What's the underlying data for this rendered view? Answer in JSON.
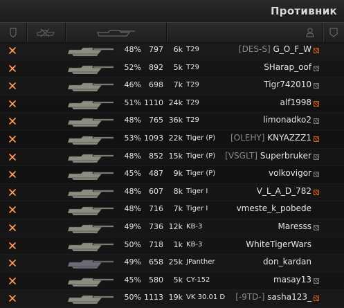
{
  "title": "Противник",
  "colors": {
    "dead_mark": "#c9561c",
    "tank_enemy": "#8c8c80",
    "tank_premium": "#6a6a78"
  },
  "rows": [
    {
      "pct": "48%",
      "battles": "797",
      "exp": "6k",
      "vehicle": "T29",
      "clan": "[DES-S]",
      "player": "G_O_F_W",
      "report": "orange"
    },
    {
      "pct": "52%",
      "battles": "892",
      "exp": "5k",
      "vehicle": "T29",
      "clan": "",
      "player": "SHarap_oof",
      "report": "grey"
    },
    {
      "pct": "46%",
      "battles": "698",
      "exp": "7k",
      "vehicle": "T29",
      "clan": "",
      "player": "Tigr742010",
      "report": "grey"
    },
    {
      "pct": "51%",
      "battles": "1110",
      "exp": "24k",
      "vehicle": "T29",
      "clan": "",
      "player": "alf1998",
      "report": "orange"
    },
    {
      "pct": "48%",
      "battles": "765",
      "exp": "36k",
      "vehicle": "T29",
      "clan": "",
      "player": "limonadko2",
      "report": "grey"
    },
    {
      "pct": "53%",
      "battles": "1093",
      "exp": "22k",
      "vehicle": "Tiger (P)",
      "clan": "[OLEHY]",
      "player": "KNYAZZZ1",
      "report": "orange"
    },
    {
      "pct": "48%",
      "battles": "852",
      "exp": "15k",
      "vehicle": "Tiger (P)",
      "clan": "[VSGLT]",
      "player": "Superbruker",
      "report": "grey"
    },
    {
      "pct": "45%",
      "battles": "487",
      "exp": "9k",
      "vehicle": "Tiger (P)",
      "clan": "",
      "player": "volkovigor",
      "report": "grey"
    },
    {
      "pct": "48%",
      "battles": "607",
      "exp": "8k",
      "vehicle": "Tiger I",
      "clan": "",
      "player": "V_L_A_D_782",
      "report": "orange"
    },
    {
      "pct": "48%",
      "battles": "716",
      "exp": "7k",
      "vehicle": "Tiger I",
      "clan": "",
      "player": "vmeste_k_pobede",
      "report": "none"
    },
    {
      "pct": "49%",
      "battles": "736",
      "exp": "12k",
      "vehicle": "KB-3",
      "clan": "",
      "player": "Maresss",
      "report": "grey"
    },
    {
      "pct": "50%",
      "battles": "718",
      "exp": "1k",
      "vehicle": "KB-3",
      "clan": "",
      "player": "WhiteTigerWars",
      "report": "none"
    },
    {
      "pct": "49%",
      "battles": "658",
      "exp": "25k",
      "vehicle": "JPanther",
      "clan": "",
      "player": "don_kardan",
      "report": "none"
    },
    {
      "pct": "45%",
      "battles": "580",
      "exp": "5k",
      "vehicle": "CY-152",
      "clan": "",
      "player": "masay13",
      "report": "grey"
    },
    {
      "pct": "50%",
      "battles": "1113",
      "exp": "19k",
      "vehicle": "VK 30.01 D",
      "clan": "[-9TD-]",
      "player": "sasha123_",
      "report": "orange"
    }
  ]
}
